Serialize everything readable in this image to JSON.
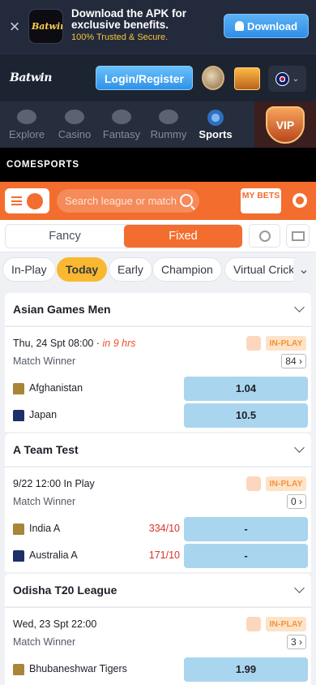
{
  "apk_banner": {
    "title": "Download the APK for exclusive benefits.",
    "subtitle": "100% Trusted & Secure.",
    "logo_text": "Batwin",
    "download_label": "Download"
  },
  "header": {
    "logo_text": "Batwin",
    "login_label": "Login/Register",
    "language_icon": "uk-flag-icon"
  },
  "categories": [
    {
      "label": "Explore",
      "icon": "explore-icon"
    },
    {
      "label": "Casino",
      "icon": "casino-icon"
    },
    {
      "label": "Fantasy",
      "icon": "fantasy-icon"
    },
    {
      "label": "Rummy",
      "icon": "rummy-icon"
    },
    {
      "label": "Sports",
      "icon": "sports-icon",
      "active": true
    }
  ],
  "vip_label": "VIP",
  "provider": "COMESPORTS",
  "toolbar": {
    "search_placeholder": "Search league or match",
    "my_bets_label": "MY BETS"
  },
  "modes": {
    "fancy": "Fancy",
    "fixed": "Fixed",
    "active": "Fixed"
  },
  "filters": [
    "In-Play",
    "Today",
    "Early",
    "Champion",
    "Virtual Crick"
  ],
  "active_filter": "Today",
  "leagues": [
    {
      "name": "Asian Games Men",
      "match": {
        "time": "Thu, 24 Spt 08:00 · ",
        "countdown": "in 9 hrs",
        "status": "IN-PLAY",
        "market": "Match Winner",
        "markets_count": "84",
        "teams": [
          {
            "name": "Afghanistan",
            "score": "",
            "odds": "1.04"
          },
          {
            "name": "Japan",
            "score": "",
            "odds": "10.5"
          }
        ]
      }
    },
    {
      "name": "A Team Test",
      "match": {
        "time": "9/22 12:00 In Play",
        "countdown": "",
        "status": "IN-PLAY",
        "market": "Match Winner",
        "markets_count": "0",
        "teams": [
          {
            "name": "India A",
            "score": "334/10",
            "odds": "-"
          },
          {
            "name": "Australia A",
            "score": "171/10",
            "odds": "-"
          }
        ]
      }
    },
    {
      "name": "Odisha T20 League",
      "match": {
        "time": "Wed, 23 Spt 22:00",
        "countdown": "",
        "status": "IN-PLAY",
        "market": "Match Winner",
        "markets_count": "3",
        "teams": [
          {
            "name": "Bhubaneshwar Tigers",
            "score": "",
            "odds": "1.99"
          }
        ]
      }
    }
  ],
  "colors": {
    "accent": "#f36d2e",
    "odds_bg": "#aad5ef",
    "inplay": "#f6923c",
    "chip_active": "#fab831"
  }
}
